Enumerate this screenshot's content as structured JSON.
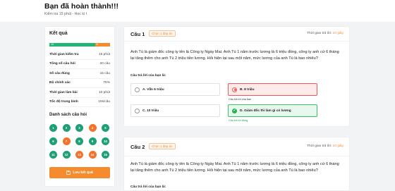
{
  "header": {
    "title": "Bạn đã hoàn thành!!!",
    "subtitle": "Kiểm tra 15 phút - Học kì I"
  },
  "summary": {
    "title": "Kết quả",
    "progress": {
      "correct_label": "15",
      "wrong_label": "5",
      "correct_fraction": 0.75
    },
    "stats": [
      {
        "label": "Thời gian kiểm tra",
        "value": "15 phút"
      },
      {
        "label": "Tổng số câu hỏi",
        "value": "20 câu"
      },
      {
        "label": "Số câu đúng",
        "value": "15 câu"
      },
      {
        "label": "Độ chính xác",
        "value": "75%"
      },
      {
        "label": "Thời gian làm bài",
        "value": "10 phút"
      },
      {
        "label": "Tốc độ trung bình",
        "value": "10s/câu"
      }
    ],
    "list_title": "Danh sách câu hỏi",
    "questions": [
      {
        "n": "1",
        "status": "correct"
      },
      {
        "n": "2",
        "status": "correct"
      },
      {
        "n": "3",
        "status": "correct"
      },
      {
        "n": "4",
        "status": "wrong"
      },
      {
        "n": "5",
        "status": "correct"
      },
      {
        "n": "6",
        "status": "correct"
      },
      {
        "n": "7",
        "status": "wrong"
      },
      {
        "n": "8",
        "status": "correct"
      },
      {
        "n": "9",
        "status": "correct"
      },
      {
        "n": "10",
        "status": "correct"
      },
      {
        "n": "11",
        "status": "correct"
      },
      {
        "n": "12",
        "status": "correct"
      },
      {
        "n": "13",
        "status": "wrong"
      },
      {
        "n": "14",
        "status": "wrong"
      },
      {
        "n": "15",
        "status": "correct"
      }
    ],
    "save_label": "Lưu kết quả",
    "save_icon": "save-icon"
  },
  "q1": {
    "label": "Câu 1",
    "badge": "Chọn 1 đáp án",
    "time_prefix": "Thời gian trả lời: ",
    "time_value": "10 giây",
    "text": "Anh Tú là giám đốc công ty tên là Công ty Ngày Mai. Anh Tú 1 năm trước lương là 6 triệu đồng, công ty anh cứ 6 tháng lại tăng thêm cho anh Tú 2 triệu tiền lương. Hỏi hiện tại sau một năm, mức lương của anh Tú là bao nhiêu?",
    "prompt": "Câu trả lời của bạn là:",
    "options": [
      {
        "label": "A. Vẫn 6 triệu"
      },
      {
        "label": "B. 8 triệu",
        "state": "wrong",
        "note": "Câu trả lời của bạn"
      },
      {
        "label": "C. 10 triệu"
      },
      {
        "label": "D. Giám đốc thì làm gì có lương",
        "state": "correct",
        "note": "Câu trả lời đúng"
      }
    ]
  },
  "q2": {
    "label": "Câu 2",
    "badge": "Chọn 1 đáp án",
    "time_prefix": "Thời gian trả lời: ",
    "time_value": "10 giây",
    "text": "Anh Tú là giám đốc công ty tên là Công ty Ngày Mai. Anh Tú 1 năm trước lương là 6 triệu đồng, công ty anh cứ 6 tháng lại tăng thêm cho anh Tú 2 triệu tiền lương. Hỏi hiện tại sau một năm, mức lương của anh Tú là bao nhiêu?",
    "prompt": "Câu trả lời của bạn là:"
  },
  "colors": {
    "accent": "#f68b2d",
    "correct": "#1e9f77",
    "wrong": "#f4722b"
  }
}
